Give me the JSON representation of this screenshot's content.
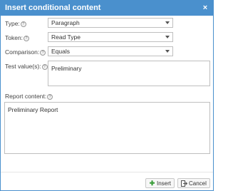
{
  "dialog": {
    "title": "Insert conditional content",
    "close_glyph": "×"
  },
  "form": {
    "type": {
      "label": "Type:",
      "value": "Paragraph"
    },
    "token": {
      "label": "Token:",
      "value": "Read Type"
    },
    "comparison": {
      "label": "Comparison:",
      "value": "Equals"
    },
    "test_values": {
      "label": "Test value(s):",
      "value": "Preliminary"
    },
    "report_content": {
      "label": "Report content:",
      "value": "Preliminary Report"
    },
    "help_glyph": "?"
  },
  "buttons": {
    "insert": {
      "label": "Insert",
      "icon": "plus-icon"
    },
    "cancel": {
      "label": "Cancel",
      "icon": "exit-icon"
    }
  },
  "colors": {
    "titlebar": "#4a90cd",
    "insert_icon": "#3a9d3a"
  }
}
